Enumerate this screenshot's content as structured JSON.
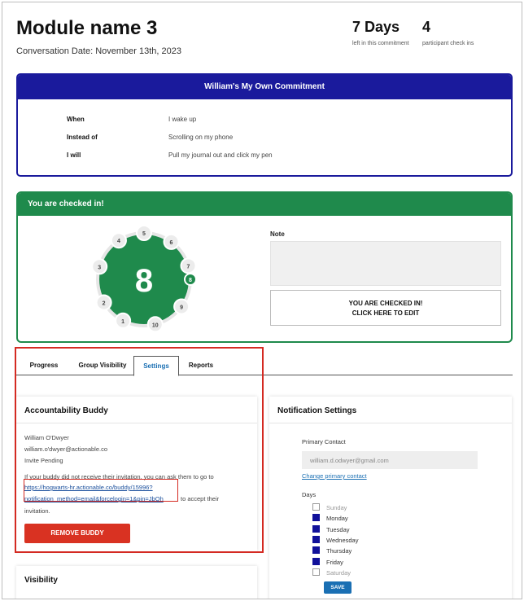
{
  "header": {
    "title": "Module name 3",
    "conversation_date": "Conversation Date: November 13th, 2023",
    "stats": [
      {
        "value": "7 Days",
        "label": "left in this commitment"
      },
      {
        "value": "4",
        "label": "participant check ins"
      }
    ]
  },
  "commitment": {
    "title": "William's My Own Commitment",
    "rows": [
      {
        "key": "When",
        "value": "I wake up"
      },
      {
        "key": "Instead of",
        "value": "Scrolling on my phone"
      },
      {
        "key": "I will",
        "value": "Pull my journal out and click my pen"
      }
    ],
    "accent_color": "#1a1a9c"
  },
  "checkin": {
    "title": "You are checked in!",
    "current": "8",
    "current_day": 8,
    "days": [
      "1",
      "2",
      "3",
      "4",
      "5",
      "6",
      "7",
      "8",
      "9",
      "10"
    ],
    "note_label": "Note",
    "note_value": "",
    "button_line1": "YOU ARE CHECKED IN!",
    "button_line2": "CLICK HERE TO EDIT",
    "accent_color": "#1f8a4c"
  },
  "tabs": [
    {
      "label": "Progress"
    },
    {
      "label": "Group Visibility"
    },
    {
      "label": "Settings",
      "active": true
    },
    {
      "label": "Reports"
    }
  ],
  "buddy": {
    "title": "Accountability Buddy",
    "name": "William O'Dwyer",
    "email": "william.o'dwyer@actionable.co",
    "status": "Invite Pending",
    "instructions": "If your buddy did not receive their invitation, you can ask them to go to",
    "link_line1": "https://hogwarts-hr.actionable.co/buddy/15996?",
    "link_line2": "notification_method=email&forcelogin=1&pin=JbQh",
    "after_link": "to accept their",
    "after_link2": "invitation.",
    "remove_label": "REMOVE BUDDY"
  },
  "visibility": {
    "title": "Visibility"
  },
  "notifications": {
    "title": "Notification Settings",
    "primary_contact_label": "Primary Contact",
    "primary_contact_value": "william.d.odwyer@gmail.com",
    "change_link": "Change primary contact",
    "days_label": "Days",
    "days": [
      {
        "label": "Sunday",
        "checked": false
      },
      {
        "label": "Monday",
        "checked": true
      },
      {
        "label": "Tuesday",
        "checked": true
      },
      {
        "label": "Wednesday",
        "checked": true
      },
      {
        "label": "Thursday",
        "checked": true
      },
      {
        "label": "Friday",
        "checked": true
      },
      {
        "label": "Saturday",
        "checked": false
      }
    ],
    "save_label": "SAVE"
  }
}
